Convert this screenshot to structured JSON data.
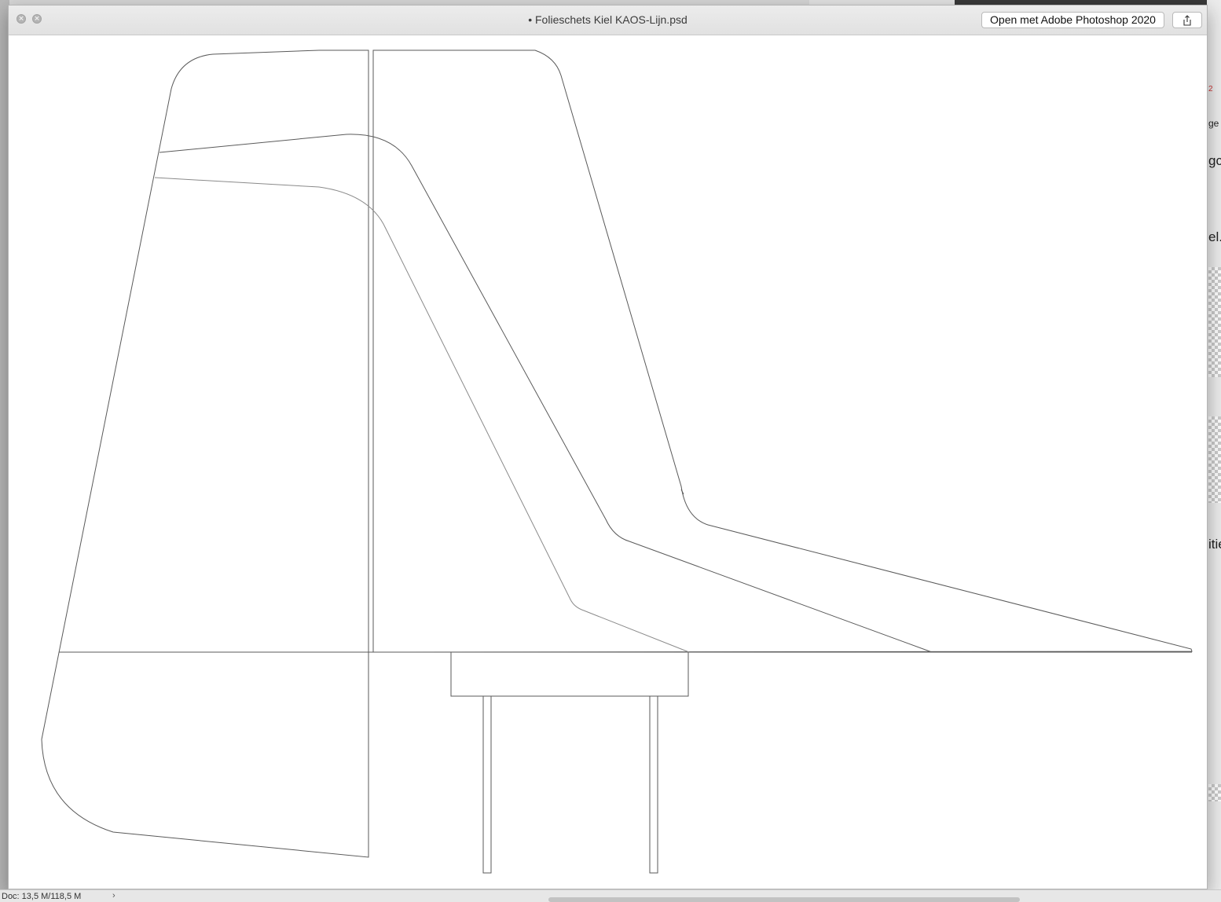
{
  "window": {
    "title": "• Folieschets Kiel KAOS-Lijn.psd",
    "open_button_label": "Open met Adobe Photoshop 2020",
    "close_glyph": "×",
    "minimize_glyph": "×"
  },
  "status": {
    "doc_size": "Doc: 13,5 M/118,5 M",
    "arrow": "›"
  },
  "background_fragments": {
    "badge": "2",
    "frag1": "ge",
    "frag2": "gc",
    "frag3": "el.",
    "frag4": "itie"
  },
  "colors": {
    "canvas_bg": "#ffffff",
    "stroke": "#5a5a5a"
  }
}
